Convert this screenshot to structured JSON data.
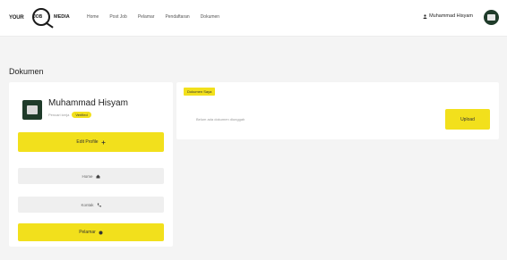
{
  "logo": {
    "left": "YOUR",
    "mid": "JOB",
    "right": "MEDIA"
  },
  "nav": [
    {
      "label": "Home"
    },
    {
      "label": "Post Job"
    },
    {
      "label": "Pelamar"
    },
    {
      "label": "Pendaftaran"
    },
    {
      "label": "Dokumen"
    }
  ],
  "user": {
    "name": "Muhammad Hisyam"
  },
  "page": {
    "title": "Dokumen"
  },
  "profile": {
    "name": "Muhammad Hisyam",
    "sub": "Pencari kerja",
    "badge": "Verified",
    "edit_label": "Edit Profile",
    "menu": [
      {
        "label": "Home"
      },
      {
        "label": "Kontak"
      },
      {
        "label": "Pelamar"
      }
    ]
  },
  "documents": {
    "label": "Dokumen Saya",
    "empty_text": "Belum ada dokumen diunggah",
    "upload_label": "Upload"
  },
  "colors": {
    "accent": "#f2e01c",
    "avatar": "#1f3b2a",
    "background": "#f4f4f4"
  }
}
